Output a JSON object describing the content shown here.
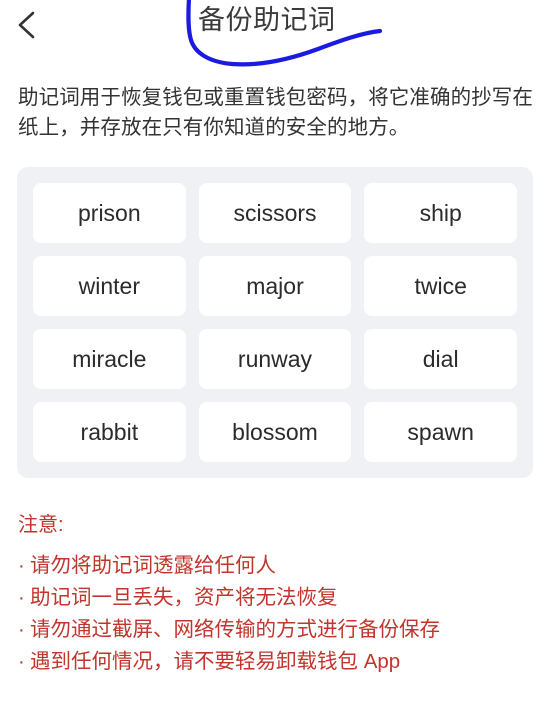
{
  "header": {
    "back_icon": "chevron-left-icon",
    "title": "备份助记词"
  },
  "annotation": {
    "color": "#1a1ae0",
    "shape": "hand-drawn-curve-underline"
  },
  "description": "助记词用于恢复钱包或重置钱包密码，将它准确的抄写在纸上，并存放在只有你知道的安全的地方。",
  "mnemonic": {
    "words": [
      "prison",
      "scissors",
      "ship",
      "winter",
      "major",
      "twice",
      "miracle",
      "runway",
      "dial",
      "rabbit",
      "blossom",
      "spawn"
    ]
  },
  "notice": {
    "title": "注意:",
    "bullet": "·",
    "items": [
      "请勿将助记词透露给任何人",
      "助记词一旦丢失，资产将无法恢复",
      "请勿通过截屏、网络传输的方式进行备份保存",
      "遇到任何情况，请不要轻易卸载钱包 App"
    ]
  },
  "colors": {
    "notice": "#c1352c",
    "panel_bg": "#f0f1f4",
    "chip_bg": "#ffffff",
    "text": "#333333",
    "annotation": "#1a1ae0"
  }
}
